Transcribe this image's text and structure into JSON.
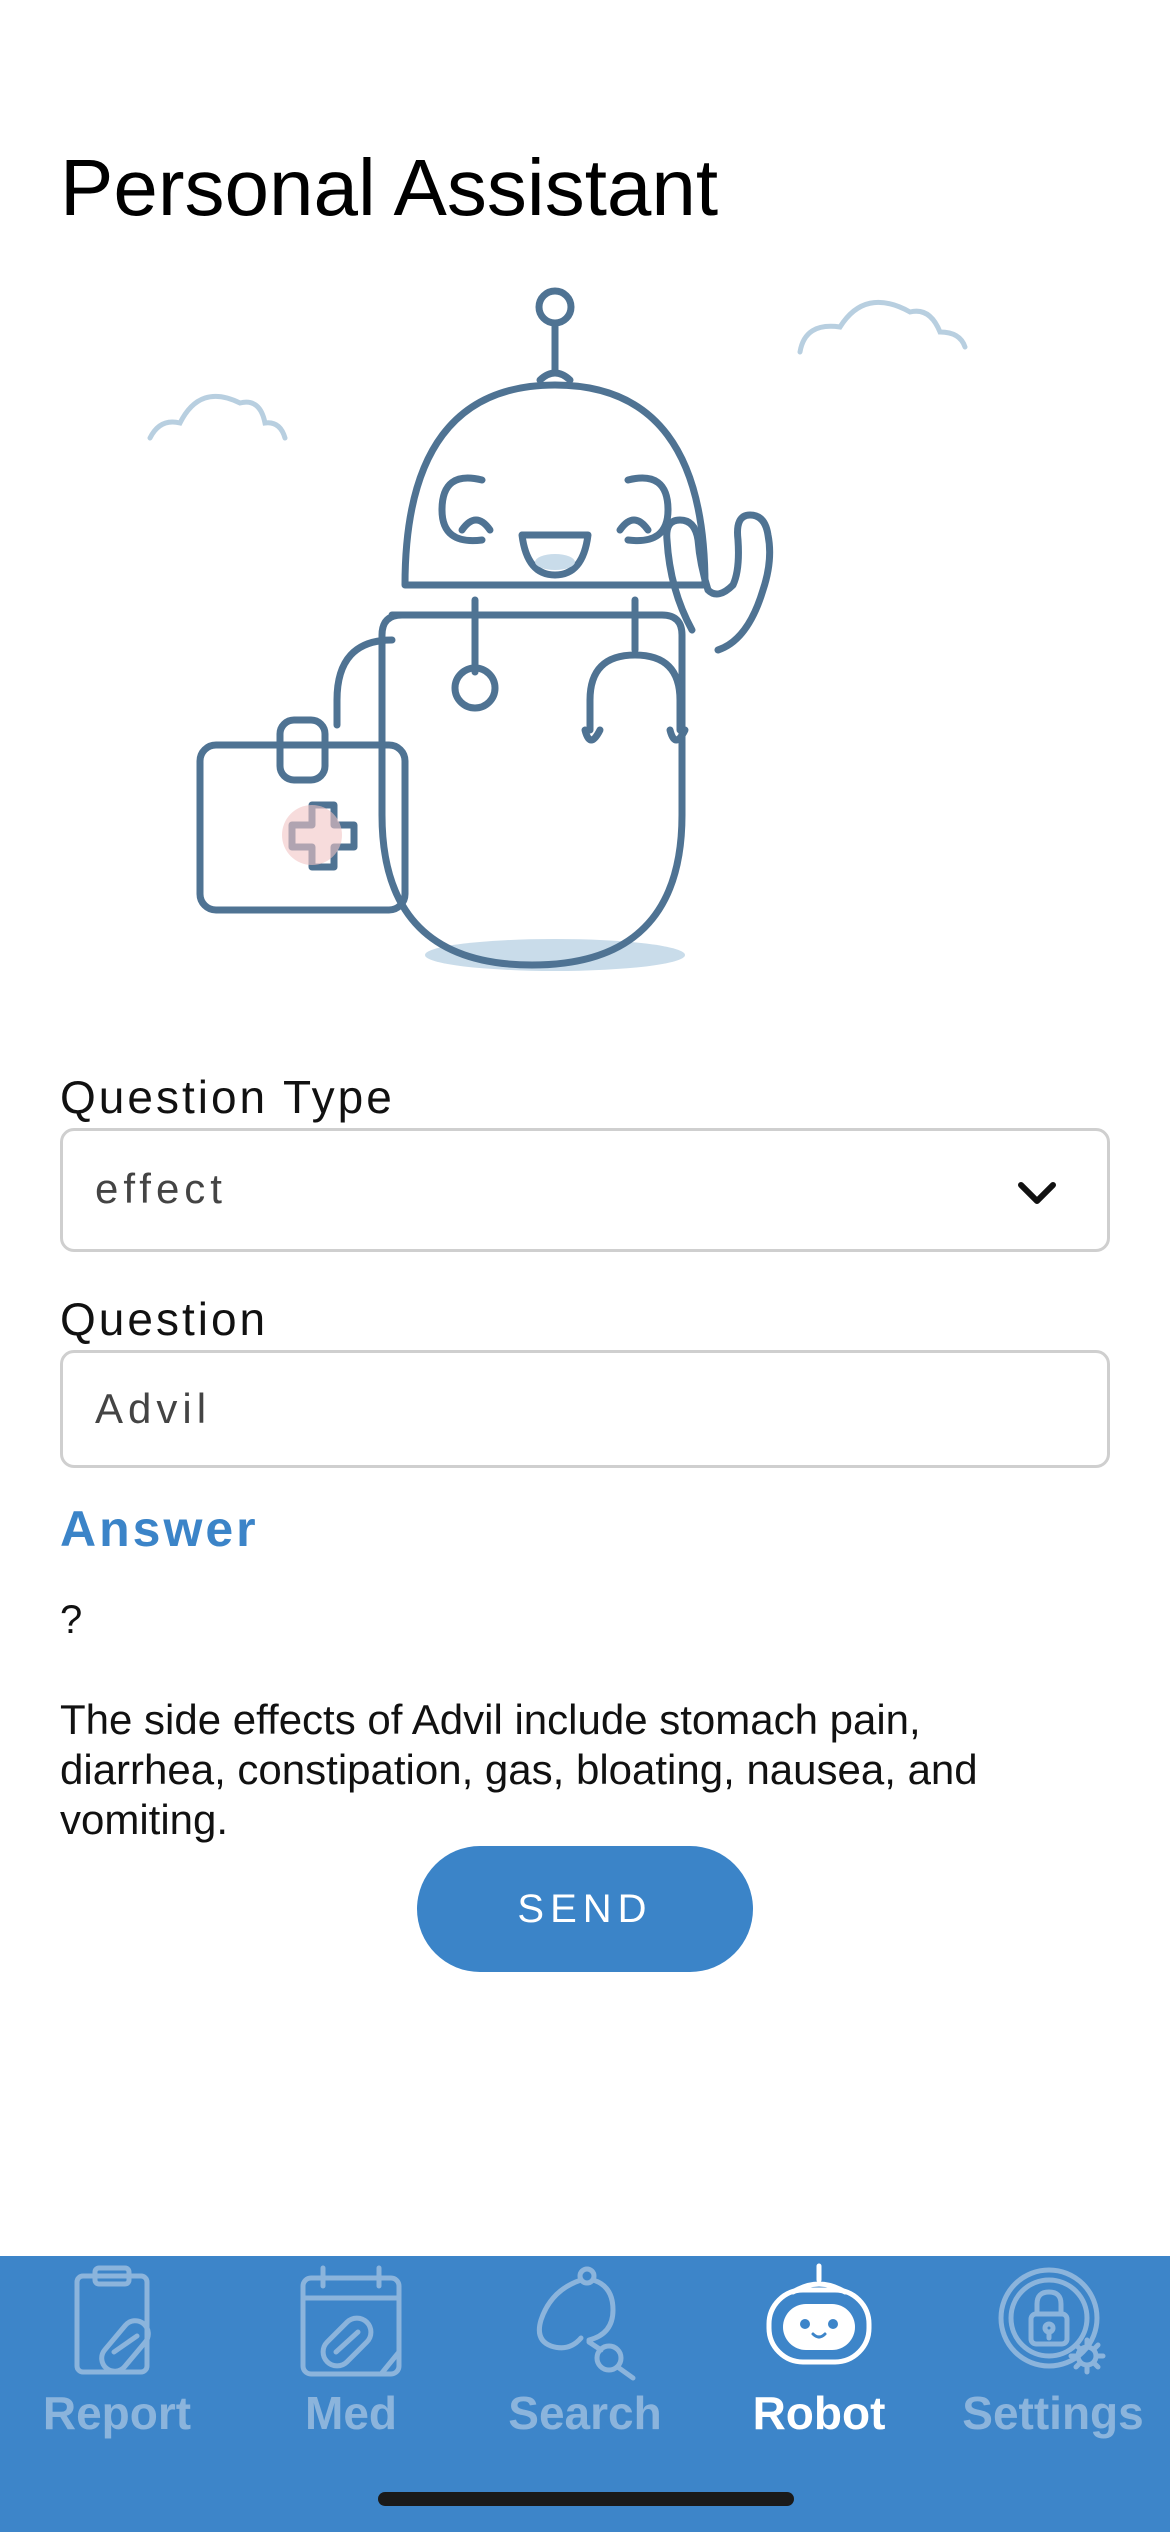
{
  "header": {
    "title": "Personal Assistant"
  },
  "illustration": {
    "icon": "robot-doctor-illustration"
  },
  "form": {
    "question_type": {
      "label": "Question Type",
      "selected": "effect"
    },
    "question": {
      "label": "Question",
      "value": "Advil"
    },
    "answer": {
      "heading": "Answer",
      "mark": "?",
      "text": "The side effects of Advil include stomach pain, diarrhea, constipation, gas, bloating, nausea, and vomiting."
    },
    "send_label": "SEND"
  },
  "tabs": [
    {
      "label": "Report",
      "icon": "clipboard-pill-icon",
      "active": false
    },
    {
      "label": "Med",
      "icon": "calendar-pill-icon",
      "active": false
    },
    {
      "label": "Search",
      "icon": "stethoscope-icon",
      "active": false
    },
    {
      "label": "Robot",
      "icon": "robot-icon",
      "active": true
    },
    {
      "label": "Settings",
      "icon": "lock-gear-icon",
      "active": false
    }
  ],
  "colors": {
    "accent": "#3b84c8",
    "tab_bar": "#3d85c9",
    "tab_inactive": "#8bb4dc",
    "tab_active": "#ffffff"
  }
}
